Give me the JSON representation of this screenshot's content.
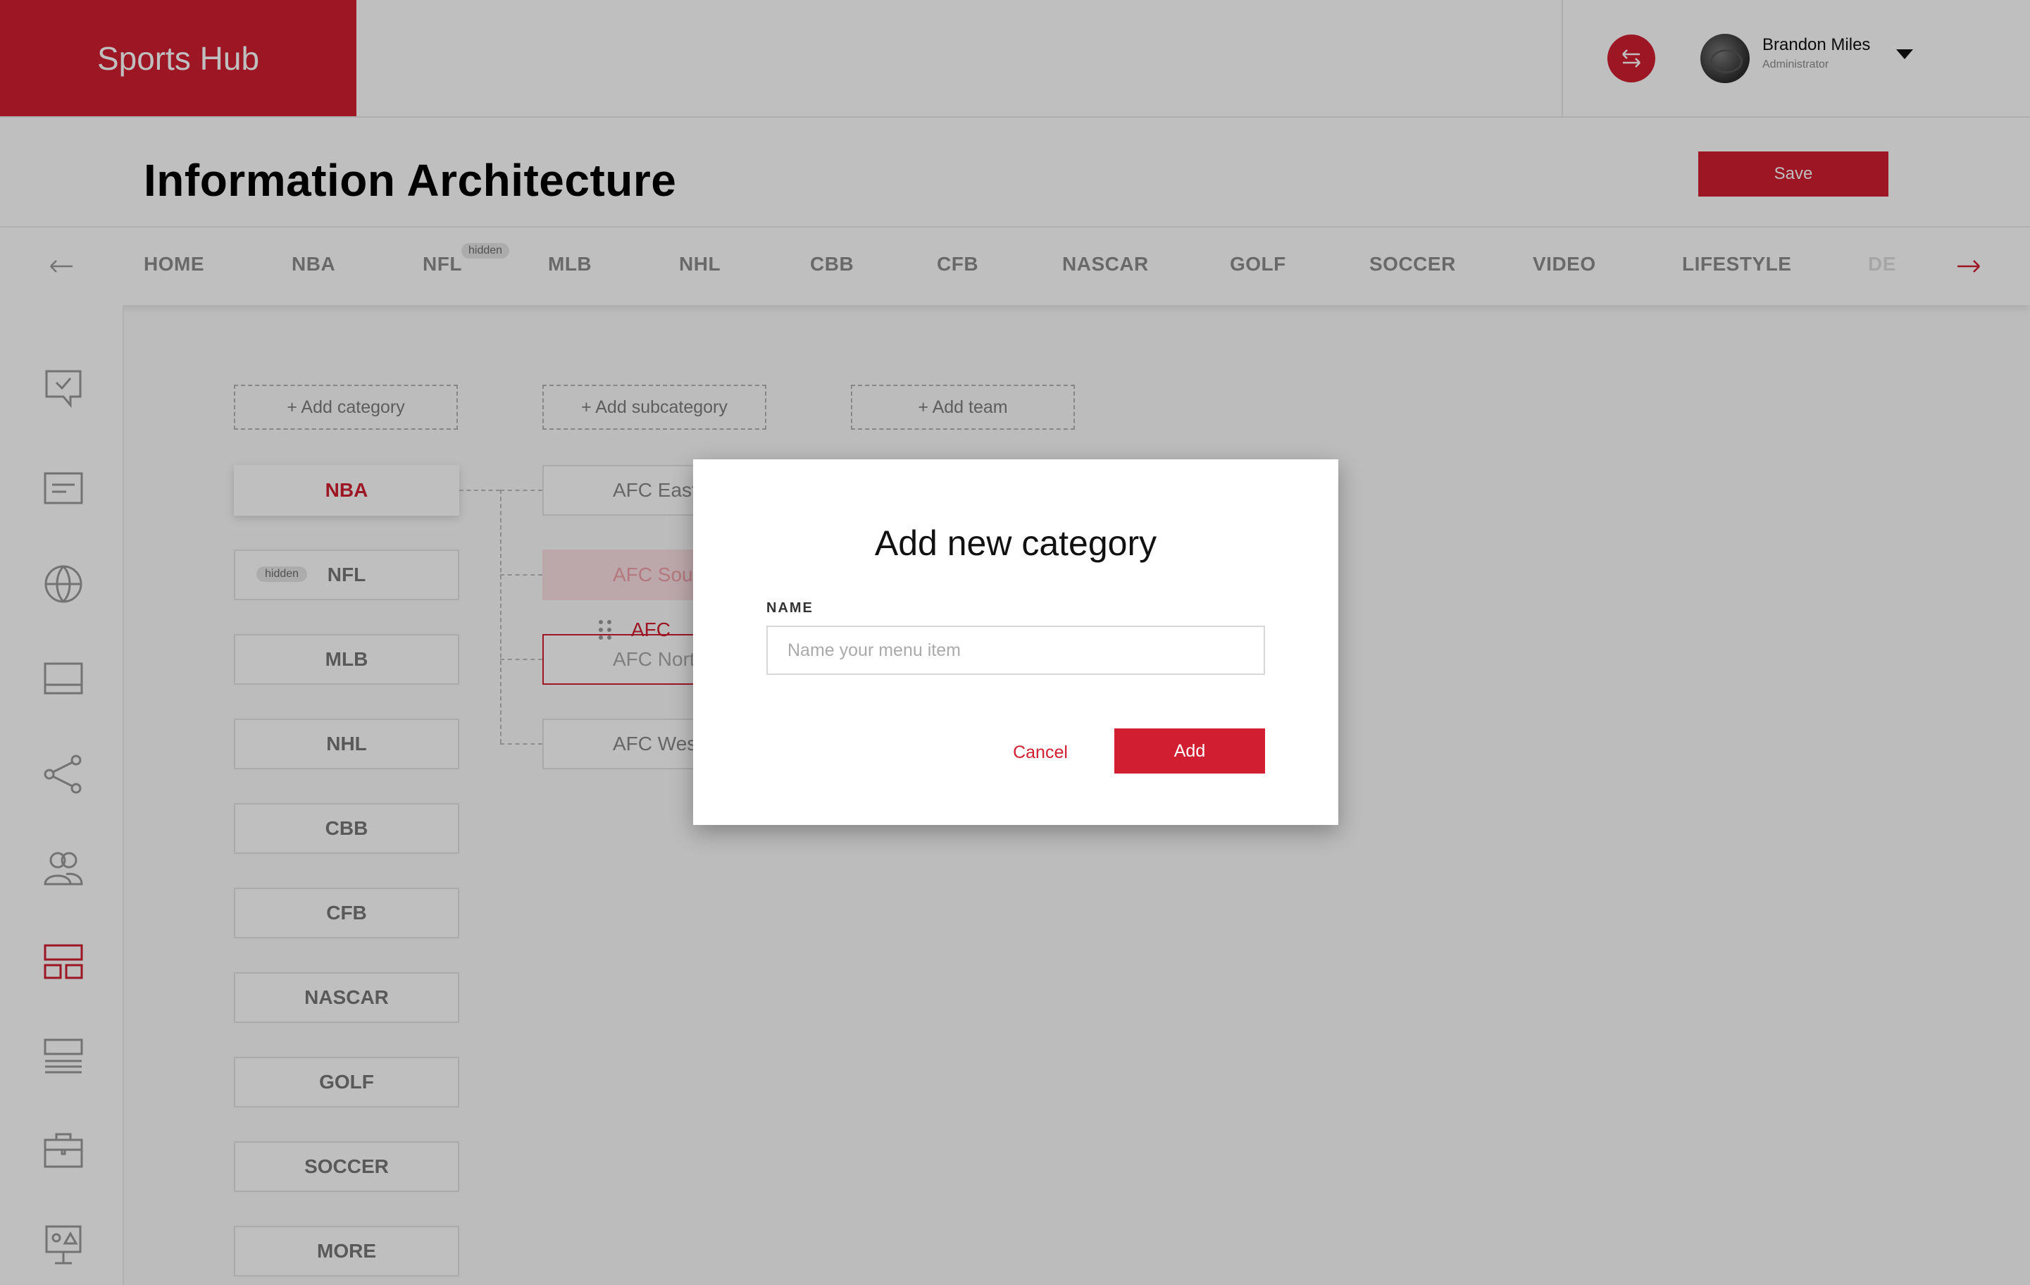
{
  "app": {
    "brand": "Sports Hub"
  },
  "user": {
    "name": "Brandon Miles",
    "role": "Administrator"
  },
  "page": {
    "title": "Information Architecture",
    "save_label": "Save"
  },
  "nav": {
    "items": [
      "HOME",
      "NBA",
      "NFL",
      "MLB",
      "NHL",
      "CBB",
      "CFB",
      "NASCAR",
      "GOLF",
      "SOCCER",
      "VIDEO",
      "LIFESTYLE",
      "DE"
    ],
    "hidden_tag": "hidden"
  },
  "canvas": {
    "add_category": "+ Add category",
    "add_subcategory": "+ Add subcategory",
    "add_team": "+ Add team",
    "categories": [
      "NBA",
      "NFL",
      "MLB",
      "NHL",
      "CBB",
      "CFB",
      "NASCAR",
      "GOLF",
      "SOCCER",
      "MORE"
    ],
    "category_hidden_tag": "hidden",
    "subcategories": [
      "AFC East",
      "AFC South",
      "AFC North",
      "AFC West"
    ],
    "drag_item": "AFC"
  },
  "modal": {
    "title": "Add new category",
    "field_label": "NAME",
    "placeholder": "Name your menu item",
    "value": "",
    "cancel_label": "Cancel",
    "add_label": "Add"
  },
  "icons": {
    "header": [
      "switch-arrows-icon",
      "chevron-down-icon"
    ],
    "sidebar": [
      "checked-comment-icon",
      "document-icon",
      "globe-icon",
      "window-icon",
      "share-icon",
      "users-icon",
      "layout-icon",
      "list-icon",
      "briefcase-icon",
      "presentation-icon"
    ]
  },
  "colors": {
    "brand": "#d11e30",
    "text_muted": "#8d8d8d"
  }
}
